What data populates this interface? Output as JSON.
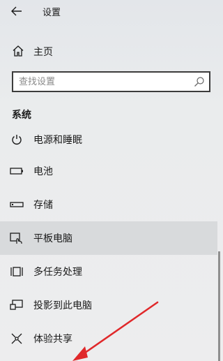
{
  "header": {
    "title": "设置"
  },
  "home": {
    "label": "主页"
  },
  "search": {
    "placeholder": "查找设置"
  },
  "section": {
    "title": "系统"
  },
  "sidebar": {
    "items": [
      {
        "label": "电源和睡眠",
        "icon": "power-icon"
      },
      {
        "label": "电池",
        "icon": "battery-icon"
      },
      {
        "label": "存储",
        "icon": "storage-icon"
      },
      {
        "label": "平板电脑",
        "icon": "tablet-icon",
        "selected": true
      },
      {
        "label": "多任务处理",
        "icon": "multitasking-icon"
      },
      {
        "label": "投影到此电脑",
        "icon": "projecting-icon"
      },
      {
        "label": "体验共享",
        "icon": "shared-experiences-icon"
      }
    ]
  },
  "annotation": {
    "arrow_color": "#e0282a"
  }
}
